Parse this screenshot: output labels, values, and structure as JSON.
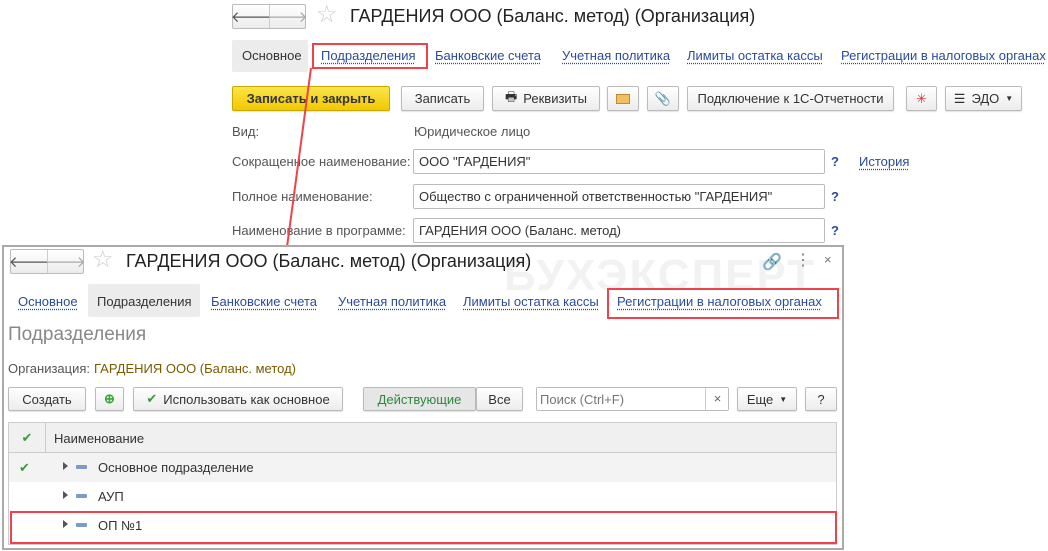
{
  "top": {
    "title": "ГАРДЕНИЯ ООО (Баланс. метод) (Организация)",
    "tabs": [
      "Основное",
      "Подразделения",
      "Банковские счета",
      "Учетная политика",
      "Лимиты остатка кассы",
      "Регистрации в налоговых органах"
    ],
    "toolbar": {
      "save_close": "Записать и закрыть",
      "save": "Записать",
      "requisites": "Реквизиты",
      "connect": "Подключение к 1С-Отчетности",
      "edo": "ЭДО"
    },
    "fields": {
      "kind_label": "Вид:",
      "kind_value": "Юридическое лицо",
      "short_label": "Сокращенное наименование:",
      "short_value": "ООО \"ГАРДЕНИЯ\"",
      "full_label": "Полное наименование:",
      "full_value": "Общество с ограниченной ответственностью \"ГАРДЕНИЯ\"",
      "prog_label": "Наименование в программе:",
      "prog_value": "ГАРДЕНИЯ ООО (Баланс. метод)",
      "help": "?",
      "history": "История"
    }
  },
  "bottom": {
    "title": "ГАРДЕНИЯ ООО (Баланс. метод) (Организация)",
    "watermark": "БУХЭКСПЕРТ",
    "tabs": [
      "Основное",
      "Подразделения",
      "Банковские счета",
      "Учетная политика",
      "Лимиты остатка кассы",
      "Регистрации в налоговых органах"
    ],
    "heading": "Подразделения",
    "org_label": "Организация:",
    "org_value": "ГАРДЕНИЯ ООО (Баланс. метод)",
    "toolbar": {
      "create": "Создать",
      "use_main": "Использовать как основное",
      "active": "Действующие",
      "all": "Все",
      "search_placeholder": "Поиск (Ctrl+F)",
      "clear": "×",
      "more": "Еще",
      "help": "?"
    },
    "table": {
      "header": "Наименование",
      "rows": [
        {
          "name": "Основное подразделение",
          "main": true
        },
        {
          "name": "АУП",
          "main": false
        },
        {
          "name": "ОП №1",
          "main": false
        }
      ]
    }
  }
}
